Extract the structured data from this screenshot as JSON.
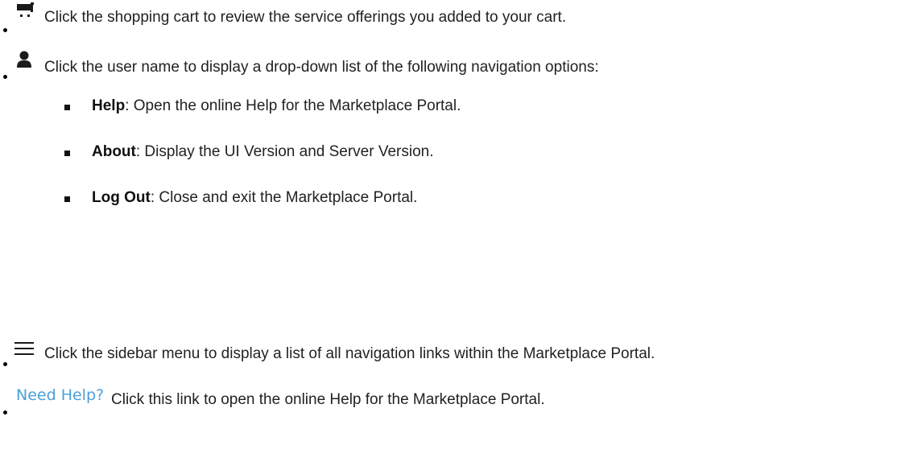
{
  "items": [
    {
      "icon": "shopping-cart-icon",
      "text": "Click the shopping cart to review the service offerings you added to your cart."
    },
    {
      "icon": "user-icon",
      "text": "Click the user name to display a drop-down list of the following navigation options:",
      "subitems": [
        {
          "term": "Help",
          "desc": ": Open the online Help for the Marketplace Portal."
        },
        {
          "term": "About",
          "desc": ": Display the UI Version and Server Version."
        },
        {
          "term": "Log Out",
          "desc": ": Close and exit the Marketplace Portal."
        }
      ]
    },
    {
      "icon": "hamburger-menu-icon",
      "text": "Click the sidebar menu to display a list of all navigation links within the Marketplace Portal."
    },
    {
      "icon_label": "Need Help?",
      "text": "Click this link to open the online Help for the Marketplace Portal."
    }
  ],
  "colors": {
    "link": "#4aa0d8",
    "text": "#222222"
  }
}
